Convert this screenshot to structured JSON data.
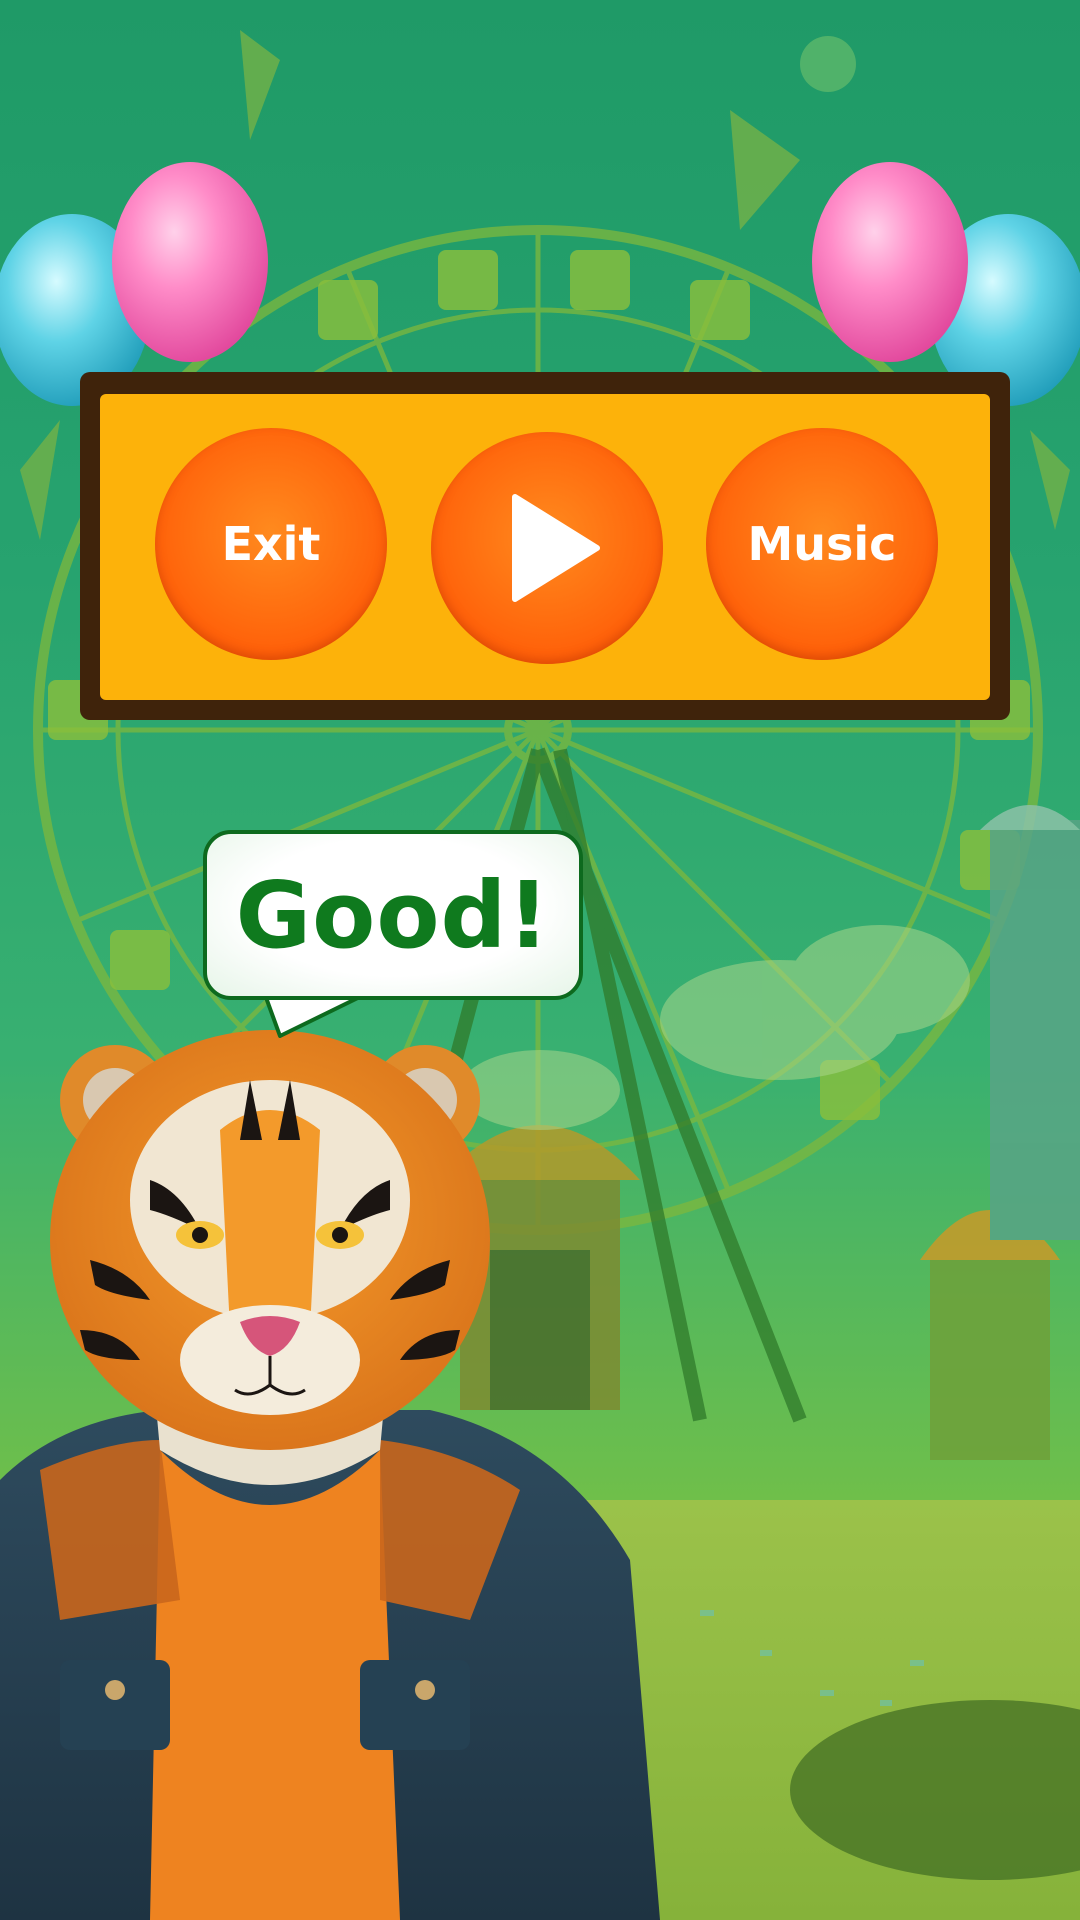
{
  "menu": {
    "exit_label": "Exit",
    "play_icon": "play-icon",
    "music_label": "Music"
  },
  "bubble": {
    "text": "Good!"
  },
  "colors": {
    "panel_border": "#3f230b",
    "panel_fill": "#fdb20a",
    "button": "#ff6a0e",
    "bubble_text": "#0f7a1e",
    "background": "#27a36f"
  }
}
